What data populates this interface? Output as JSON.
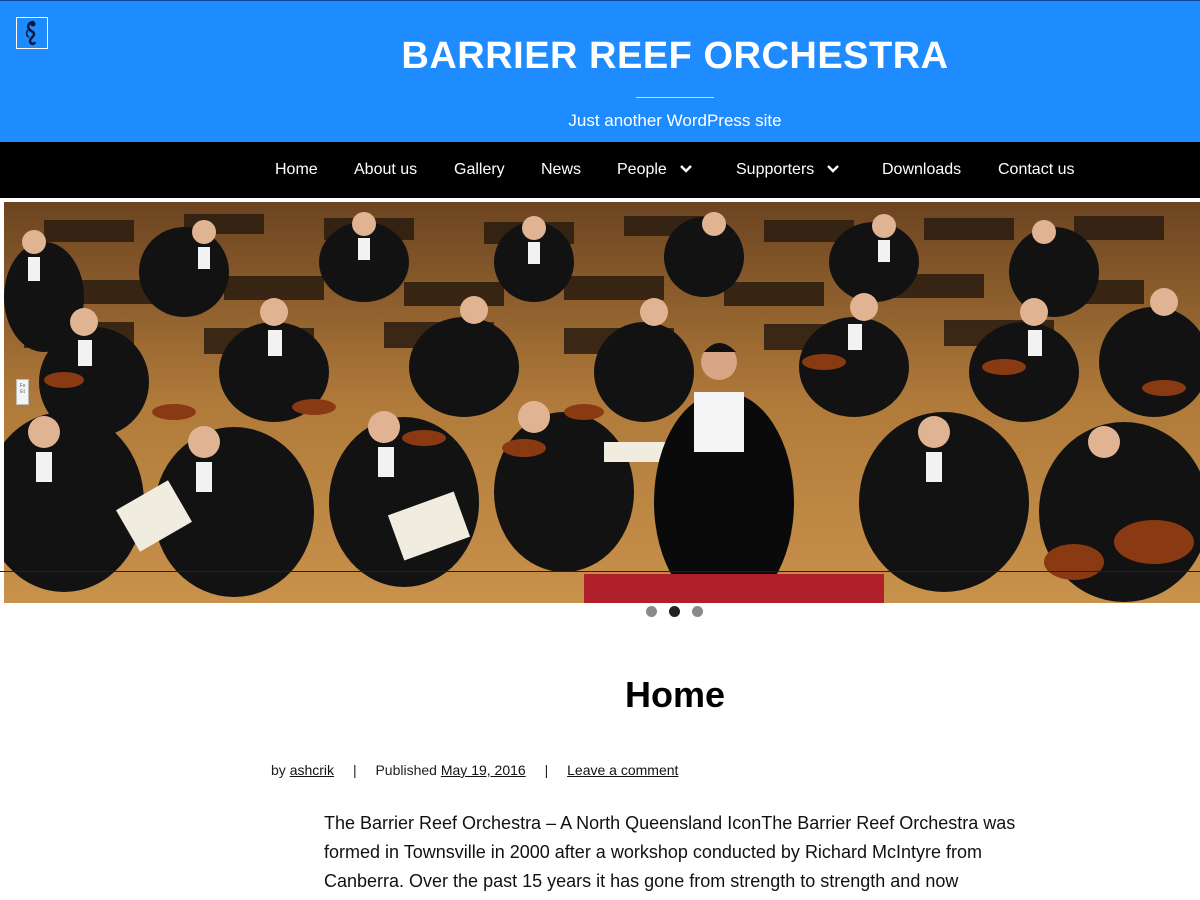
{
  "header": {
    "site_title": "BARRIER REEF ORCHESTRA",
    "tagline": "Just another WordPress site",
    "logo_icon": "seahorse-treble-clef-icon"
  },
  "nav": {
    "items": [
      {
        "label": "Home"
      },
      {
        "label": "About us"
      },
      {
        "label": "Gallery"
      },
      {
        "label": "News"
      },
      {
        "label": "People",
        "dropdown": true
      },
      {
        "label": "Supporters",
        "dropdown": true
      },
      {
        "label": "Downloads"
      },
      {
        "label": "Contact us"
      }
    ]
  },
  "hero": {
    "image_subject": "orchestra performing with conductor",
    "side_tab_text": "Fo Et",
    "slides_count": 3,
    "active_slide": 2
  },
  "page": {
    "title": "Home",
    "meta": {
      "by_label": "by",
      "author": "ashcrik",
      "sep": "|",
      "published_label": "Published",
      "date": "May 19, 2016",
      "comment_link": "Leave a comment"
    },
    "content_lines": [
      "The Barrier Reef Orchestra – A North Queensland IconThe Barrier Reef Orchestra was",
      "formed in Townsville in 2000 after a workshop conducted by Richard McIntyre from",
      "Canberra. Over the past 15 years it has gone from strength to strength and now"
    ]
  },
  "colors": {
    "header_bg": "#1e8cff",
    "nav_bg": "#000000",
    "text": "#111111"
  }
}
